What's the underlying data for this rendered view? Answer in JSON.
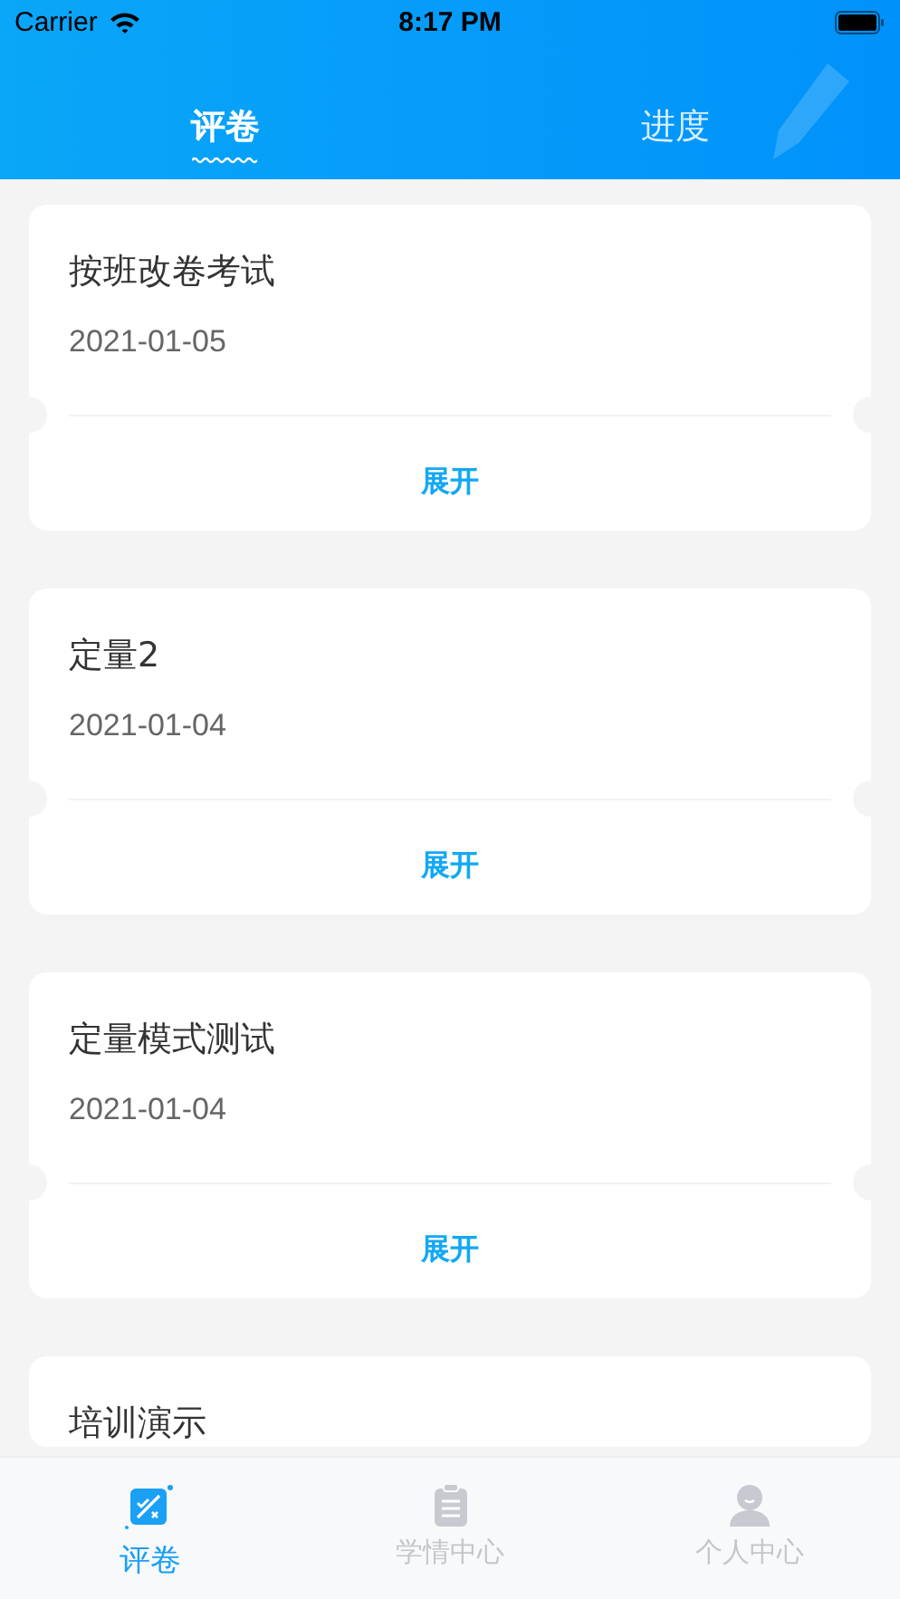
{
  "status_bar": {
    "carrier": "Carrier",
    "time": "8:17 PM"
  },
  "tabs": [
    {
      "label": "评卷",
      "selected": true
    },
    {
      "label": "进度",
      "selected": false
    }
  ],
  "exams": [
    {
      "title": "按班改卷考试",
      "date": "2021-01-05",
      "action": "展开"
    },
    {
      "title": "定量2",
      "date": "2021-01-04",
      "action": "展开"
    },
    {
      "title": "定量模式测试",
      "date": "2021-01-04",
      "action": "展开"
    },
    {
      "title": "培训演示"
    }
  ],
  "tab_bar": [
    {
      "label": "评卷",
      "kind": "grading",
      "selected": true
    },
    {
      "label": "学情中心",
      "kind": "clipboard",
      "selected": false
    },
    {
      "label": "个人中心",
      "kind": "person",
      "selected": false
    }
  ]
}
